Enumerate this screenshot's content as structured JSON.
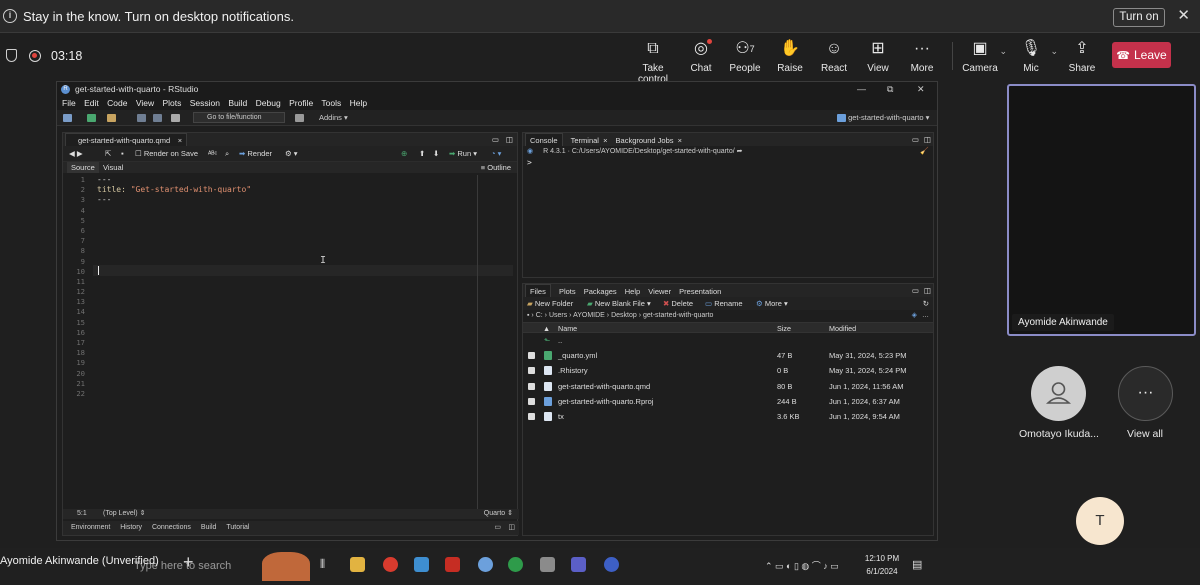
{
  "notification": {
    "message": "Stay in the know. Turn on desktop notifications.",
    "turn_on": "Turn on"
  },
  "meeting": {
    "timer": "03:18",
    "toolbar": [
      {
        "label": "Take control",
        "icon": "take-control-icon"
      },
      {
        "label": "Chat",
        "icon": "chat-icon"
      },
      {
        "label": "People",
        "icon": "people-icon",
        "count": "7"
      },
      {
        "label": "Raise",
        "icon": "raise-hand-icon"
      },
      {
        "label": "React",
        "icon": "react-icon"
      },
      {
        "label": "View",
        "icon": "view-icon"
      },
      {
        "label": "More",
        "icon": "more-icon"
      },
      {
        "label": "Camera",
        "icon": "camera-off-icon"
      },
      {
        "label": "Mic",
        "icon": "mic-off-icon"
      },
      {
        "label": "Share",
        "icon": "share-icon"
      }
    ],
    "leave": "Leave",
    "colors": {
      "leave": "#c4314b",
      "active_tile": "#8b8cc7",
      "recording": "#e0443e"
    }
  },
  "rstudio": {
    "title": "get-started-with-quarto - RStudio",
    "menu": [
      "File",
      "Edit",
      "Code",
      "View",
      "Plots",
      "Session",
      "Build",
      "Debug",
      "Profile",
      "Tools",
      "Help"
    ],
    "goto": "Go to file/function",
    "addins": "Addins",
    "project": "get-started-with-quarto",
    "editor": {
      "file_tab": "get-started-with-quarto.qmd",
      "render_on_save": "Render on Save",
      "render": "Render",
      "run": "Run",
      "source": "Source",
      "visual": "Visual",
      "outline": "Outline",
      "lines": [
        "---",
        "title: \"Get-started-with-quarto\"",
        "---",
        "",
        "",
        "",
        "",
        "",
        "",
        "",
        "",
        "",
        "",
        "",
        "",
        "",
        "",
        "",
        "",
        "",
        "",
        ""
      ],
      "position": "5:1",
      "scope": "(Top Level)",
      "filetype": "Quarto"
    },
    "env_tabs": [
      "Environment",
      "History",
      "Connections",
      "Build",
      "Tutorial"
    ],
    "console": {
      "tabs": [
        "Console",
        "Terminal",
        "Background Jobs"
      ],
      "path": "R 4.3.1 · C:/Users/AYOMIDE/Desktop/get-started-with-quarto/",
      "prompt": ">"
    },
    "files": {
      "tabs": [
        "Files",
        "Plots",
        "Packages",
        "Help",
        "Viewer",
        "Presentation"
      ],
      "new_folder": "New Folder",
      "new_blank_file": "New Blank File",
      "delete": "Delete",
      "rename": "Rename",
      "more": "More",
      "breadcrumb": [
        "C:",
        "Users",
        "AYOMIDE",
        "Desktop",
        "get-started-with-quarto"
      ],
      "columns": [
        "Name",
        "Size",
        "Modified"
      ],
      "up": "..",
      "rows": [
        {
          "name": "_quarto.yml",
          "size": "47 B",
          "modified": "May 31, 2024, 5:23 PM"
        },
        {
          "name": ".Rhistory",
          "size": "0 B",
          "modified": "May 31, 2024, 5:24 PM"
        },
        {
          "name": "get-started-with-quarto.qmd",
          "size": "80 B",
          "modified": "Jun 1, 2024, 11:56 AM"
        },
        {
          "name": "get-started-with-quarto.Rproj",
          "size": "244 B",
          "modified": "Jun 1, 2024, 6:37 AM"
        },
        {
          "name": "tx",
          "size": "3.6 KB",
          "modified": "Jun 1, 2024, 9:54 AM"
        }
      ]
    }
  },
  "taskbar": {
    "search": "Type here to search",
    "time": "12:10 PM",
    "date": "6/1/2024"
  },
  "speaker": "Ayomide Akinwande (Unverified)",
  "participants": {
    "self_tile": "Ayomide Akinwande",
    "other": "Omotayo Ikuda...",
    "view_all": "View all",
    "initial": "T"
  }
}
